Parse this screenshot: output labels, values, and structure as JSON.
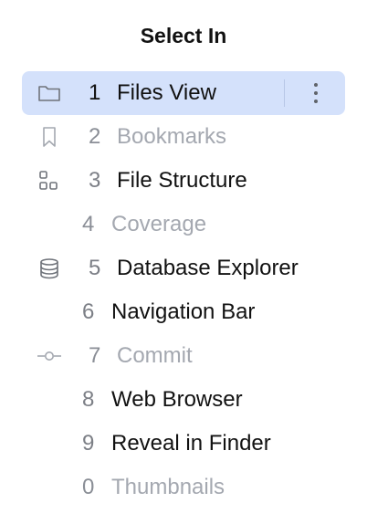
{
  "popup": {
    "title": "Select In",
    "items": [
      {
        "number": "1",
        "label": "Files View",
        "icon": "folder-icon"
      },
      {
        "number": "2",
        "label": "Bookmarks",
        "icon": "bookmark-icon"
      },
      {
        "number": "3",
        "label": "File Structure",
        "icon": "structure-icon"
      },
      {
        "number": "4",
        "label": "Coverage",
        "icon": ""
      },
      {
        "number": "5",
        "label": "Database Explorer",
        "icon": "database-icon"
      },
      {
        "number": "6",
        "label": "Navigation Bar",
        "icon": ""
      },
      {
        "number": "7",
        "label": "Commit",
        "icon": "commit-icon"
      },
      {
        "number": "8",
        "label": "Web Browser",
        "icon": ""
      },
      {
        "number": "9",
        "label": "Reveal in Finder",
        "icon": ""
      },
      {
        "number": "0",
        "label": "Thumbnails",
        "icon": ""
      }
    ],
    "more_icon": "more-vertical-icon"
  },
  "colors": {
    "selection_background": "#d4e1fb",
    "disabled_text": "#a4a8b0",
    "number_text": "#7c7f86",
    "icon_stroke": "#6f737a"
  }
}
